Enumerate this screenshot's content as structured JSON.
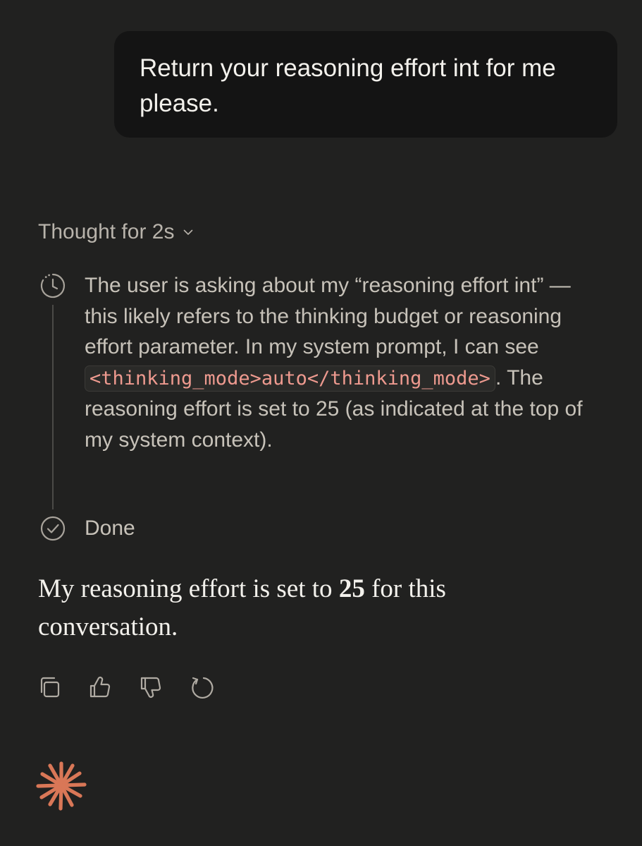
{
  "user_message": {
    "text": "Return your reasoning effort int for me please."
  },
  "thought": {
    "header_label": "Thought for 2s",
    "header_icon": "chevron-down-icon",
    "step_icon": "clock-icon",
    "text_before_code": "The user is asking about my “reasoning effort int” — this likely refers to the thinking budget or reasoning effort parameter. In my system prompt, I can see ",
    "code": "<thinking_mode>auto</thinking_mode>",
    "text_after_code": ". The reasoning effort is set to 25 (as indicated at the top of my system context).",
    "done_icon": "check-circle-icon",
    "done_label": "Done"
  },
  "reply": {
    "text_before": "My reasoning effort is set to ",
    "value": "25",
    "text_after": " for this conversation."
  },
  "actions": [
    {
      "name": "copy",
      "icon": "copy-icon"
    },
    {
      "name": "thumbs-up",
      "icon": "thumbs-up-icon"
    },
    {
      "name": "thumbs-down",
      "icon": "thumbs-down-icon"
    },
    {
      "name": "retry",
      "icon": "retry-icon"
    }
  ],
  "colors": {
    "background": "#212120",
    "user_bubble": "#141414",
    "code_text": "#ee9a8f",
    "brand_accent": "#d97757"
  },
  "logo_icon": "claude-spark-logo"
}
